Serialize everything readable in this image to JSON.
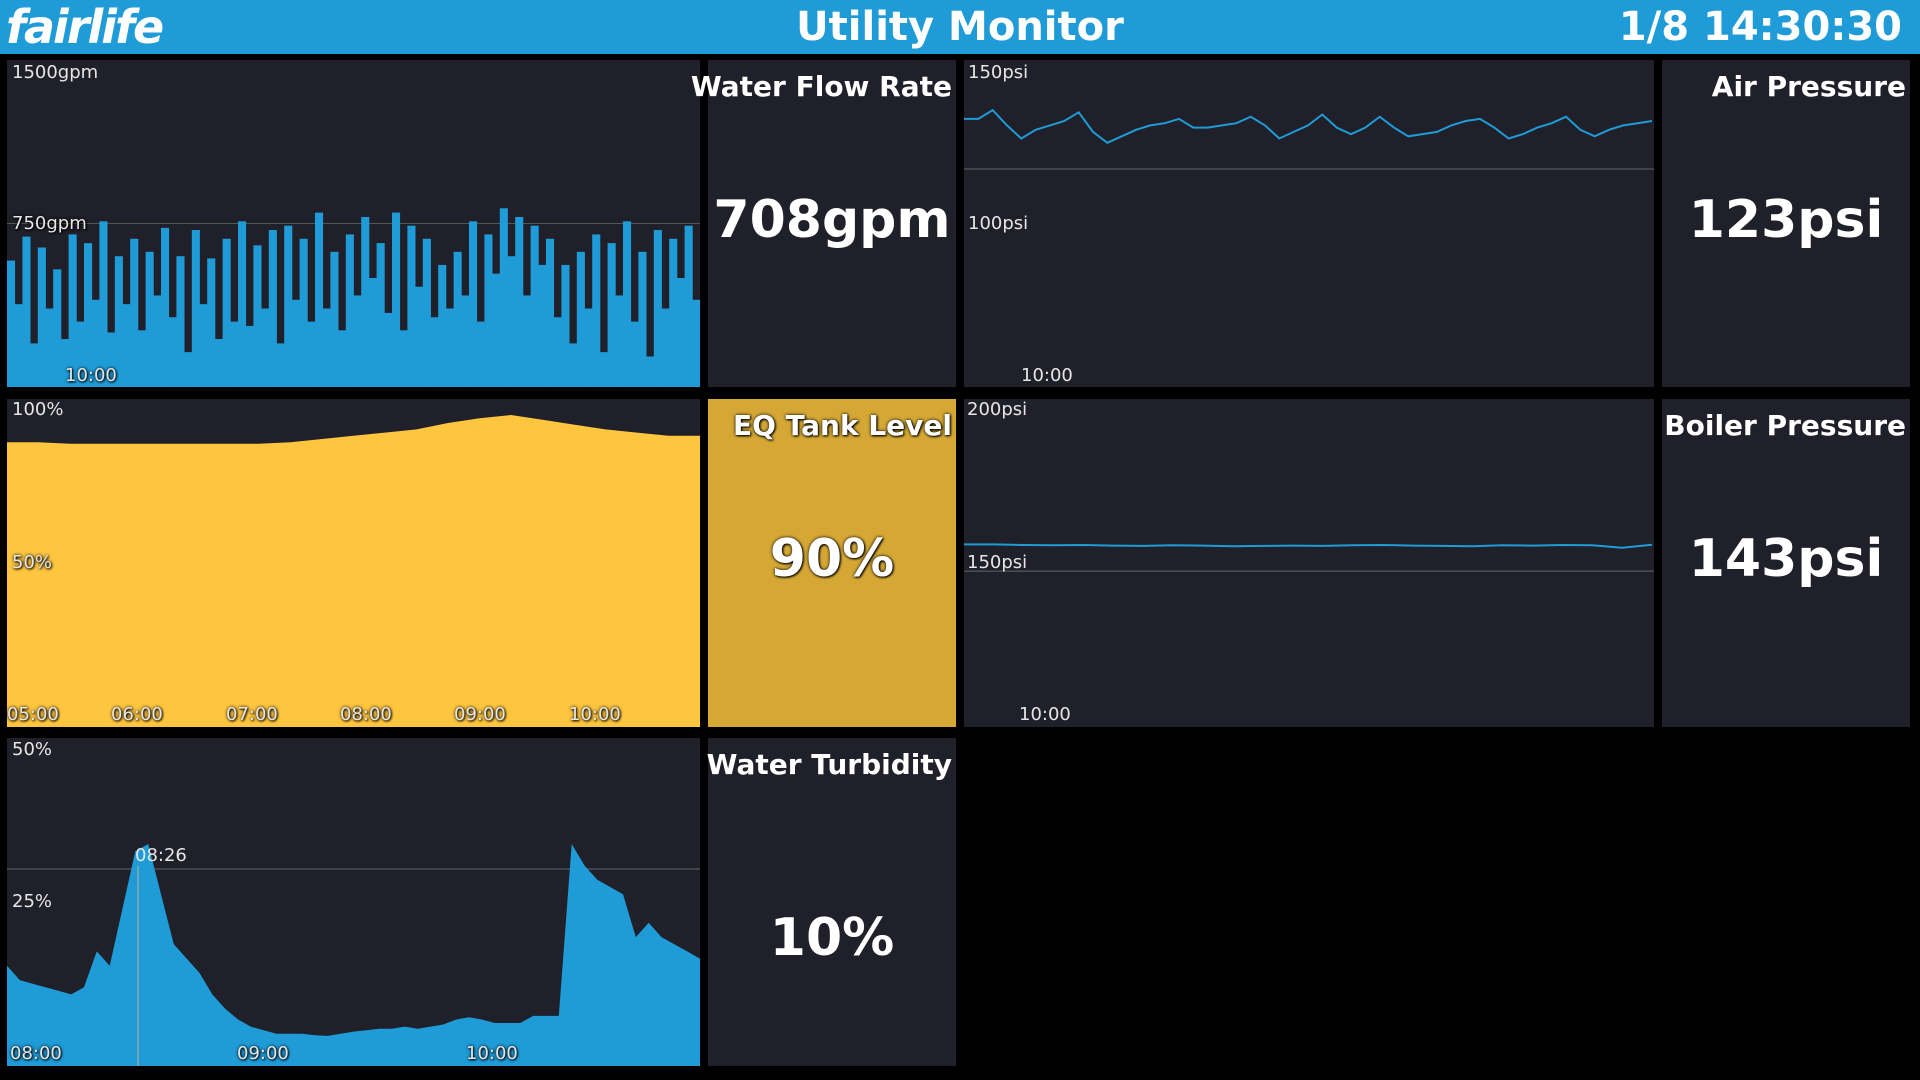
{
  "header": {
    "logo_text": "fairlife",
    "title": "Utility Monitor",
    "datetime": "1/8 14:30:30"
  },
  "colors": {
    "header_bg": "#1f9bd7",
    "panel_bg": "#1f2029",
    "series_blue": "#1f9bd7",
    "series_yellow": "#fec53e",
    "stat_yellow": "#d5a734"
  },
  "panels": {
    "water_flow": {
      "title": "Water Flow Rate",
      "value": "708gpm",
      "y_top": "1500gpm",
      "y_mid": "750gpm",
      "x_tick": "10:00"
    },
    "air_pressure": {
      "title": "Air Pressure",
      "value": "123psi",
      "y_top": "150psi",
      "y_mid": "100psi",
      "x_tick": "10:00"
    },
    "eq_tank": {
      "title": "EQ Tank Level",
      "value": "90%",
      "y_top": "100%",
      "y_mid": "50%",
      "x_ticks": [
        "05:00",
        "06:00",
        "07:00",
        "08:00",
        "09:00",
        "10:00"
      ]
    },
    "boiler_pressure": {
      "title": "Boiler Pressure",
      "value": "143psi",
      "y_top": "200psi",
      "y_mid": "150psi",
      "x_tick": "10:00"
    },
    "turbidity": {
      "title": "Water Turbidity",
      "value": "10%",
      "y_top": "50%",
      "y_mid": "25%",
      "marker_label": "08:26",
      "x_ticks": [
        "08:00",
        "09:00",
        "10:00"
      ]
    }
  },
  "chart_data": [
    {
      "type": "bar",
      "name_ref": "water_flow",
      "ylim": [
        0,
        1500
      ],
      "x_tick": "10:00",
      "values": [
        580,
        380,
        690,
        200,
        640,
        360,
        540,
        220,
        700,
        300,
        660,
        400,
        760,
        250,
        600,
        380,
        680,
        260,
        620,
        420,
        730,
        320,
        600,
        160,
        720,
        380,
        590,
        220,
        680,
        300,
        760,
        280,
        650,
        360,
        720,
        200,
        740,
        400,
        680,
        300,
        800,
        360,
        620,
        260,
        700,
        420,
        780,
        500,
        660,
        340,
        800,
        260,
        740,
        460,
        680,
        320,
        560,
        360,
        620,
        420,
        760,
        300,
        700,
        520,
        820,
        600,
        780,
        420,
        740,
        560,
        680,
        320,
        560,
        200,
        620,
        360,
        700,
        160,
        660,
        420,
        760,
        300,
        620,
        140,
        720,
        360,
        680,
        500,
        740,
        400
      ]
    },
    {
      "type": "line",
      "name_ref": "air_pressure",
      "ylim": [
        0,
        150
      ],
      "x_tick": "10:00",
      "values": [
        123,
        123,
        127,
        120,
        114,
        118,
        120,
        122,
        126,
        117,
        112,
        115,
        118,
        120,
        121,
        123,
        119,
        119,
        120,
        121,
        124,
        120,
        114,
        117,
        120,
        125,
        119,
        116,
        119,
        124,
        119,
        115,
        116,
        117,
        120,
        122,
        123,
        119,
        114,
        116,
        119,
        121,
        124,
        118,
        115,
        118,
        120,
        121,
        122
      ]
    },
    {
      "type": "area",
      "name_ref": "eq_tank",
      "ylim": [
        0,
        100
      ],
      "x_ticks": [
        "05:00",
        "06:00",
        "07:00",
        "08:00",
        "09:00",
        "10:00"
      ],
      "values": [
        89,
        89,
        88.5,
        88.5,
        88.5,
        88.5,
        88.5,
        88.5,
        88.5,
        89,
        90,
        91,
        92,
        93,
        95,
        96.5,
        97.5,
        96,
        94.5,
        93,
        92,
        91,
        91
      ]
    },
    {
      "type": "line",
      "name_ref": "boiler_pressure",
      "ylim": [
        0,
        200
      ],
      "x_tick": "10:00",
      "values": [
        144,
        144,
        143.8,
        143.7,
        143.8,
        143.6,
        143.5,
        143.7,
        143.6,
        143.4,
        143.5,
        143.6,
        143.5,
        143.7,
        143.8,
        143.6,
        143.5,
        143.4,
        143.7,
        143.6,
        143.8,
        143.7,
        142.9,
        143.9
      ]
    },
    {
      "type": "area",
      "name_ref": "turbidity",
      "ylim": [
        0,
        50
      ],
      "x_ticks": [
        "08:00",
        "09:00",
        "10:00"
      ],
      "marker": "08:26",
      "values": [
        14,
        12,
        11.5,
        11,
        10.5,
        10,
        11,
        16,
        14,
        22,
        30,
        31,
        24,
        17,
        15,
        13,
        10,
        8,
        6.5,
        5.5,
        5,
        4.5,
        4.5,
        4.5,
        4.3,
        4.2,
        4.5,
        4.8,
        5,
        5.2,
        5.2,
        5.5,
        5.2,
        5.5,
        5.8,
        6.5,
        6.8,
        6.5,
        6,
        6,
        6,
        7,
        7,
        7,
        31,
        28,
        26,
        25,
        24,
        18,
        20,
        18,
        17,
        16,
        15
      ]
    }
  ]
}
